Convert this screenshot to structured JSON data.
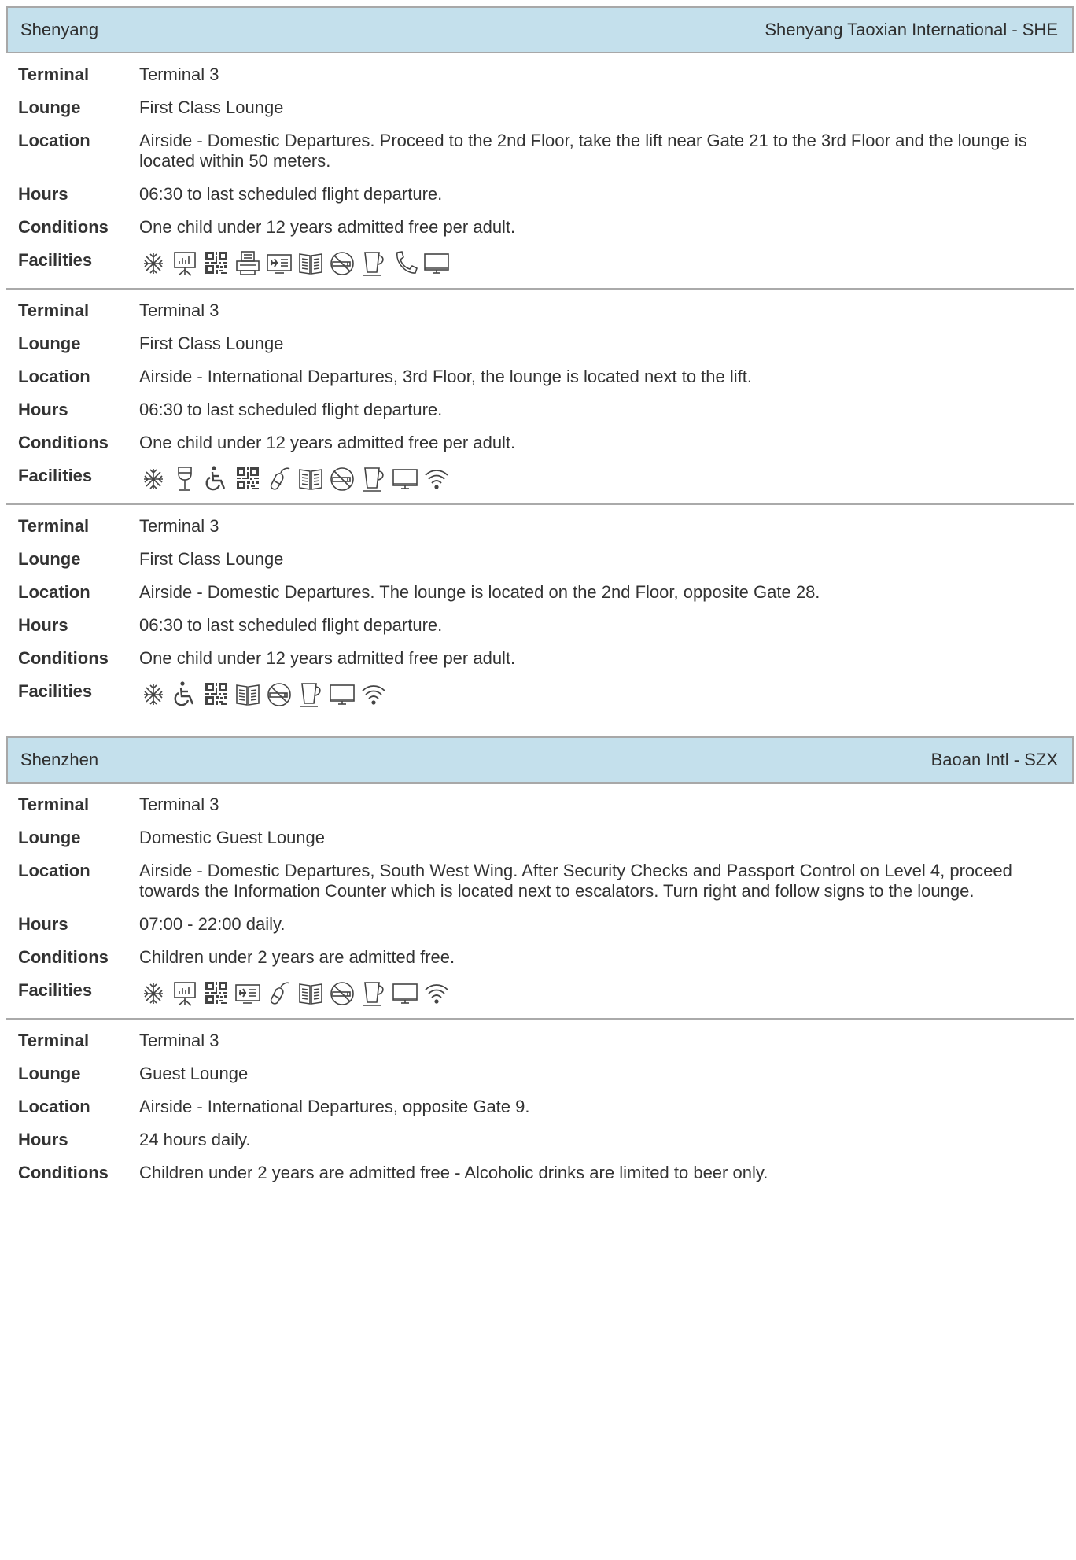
{
  "labels": {
    "terminal": "Terminal",
    "lounge": "Lounge",
    "location": "Location",
    "hours": "Hours",
    "conditions": "Conditions",
    "facilities": "Facilities"
  },
  "cities": [
    {
      "city": "Shenyang",
      "airport": "Shenyang Taoxian International - SHE",
      "lounges": [
        {
          "terminal": "Terminal 3",
          "lounge": "First Class Lounge",
          "location": "Airside - Domestic Departures. Proceed to the 2nd Floor, take the lift near Gate 21 to the 3rd Floor and the lounge is located within 50 meters.",
          "hours": "06:30 to last scheduled flight departure.",
          "conditions": "One child under 12 years admitted free per adult.",
          "facilities": [
            "air-conditioning-icon",
            "conference-icon",
            "flight-info-qr-icon",
            "fax-icon",
            "flight-monitor-icon",
            "newspapers-icon",
            "no-smoking-icon",
            "refreshments-icon",
            "telephone-icon",
            "tv-icon"
          ]
        },
        {
          "terminal": "Terminal 3",
          "lounge": "First Class Lounge",
          "location": "Airside - International Departures, 3rd Floor, the lounge is located next to the lift.",
          "hours": "06:30 to last scheduled flight departure.",
          "conditions": "One child under 12 years admitted free per adult.",
          "facilities": [
            "air-conditioning-icon",
            "alcohol-icon",
            "wheelchair-icon",
            "flight-info-qr-icon",
            "internet-mouse-icon",
            "newspapers-icon",
            "no-smoking-icon",
            "refreshments-icon",
            "tv-icon",
            "wifi-icon"
          ]
        },
        {
          "terminal": "Terminal 3",
          "lounge": "First Class Lounge",
          "location": "Airside - Domestic Departures. The lounge is located on the 2nd Floor, opposite Gate 28.",
          "hours": "06:30 to last scheduled flight departure.",
          "conditions": "One child under 12 years admitted free per adult.",
          "facilities": [
            "air-conditioning-icon",
            "wheelchair-icon",
            "flight-info-qr-icon",
            "newspapers-icon",
            "no-smoking-icon",
            "refreshments-icon",
            "tv-icon",
            "wifi-icon"
          ]
        }
      ]
    },
    {
      "city": "Shenzhen",
      "airport": "Baoan Intl - SZX",
      "lounges": [
        {
          "terminal": "Terminal 3",
          "lounge": "Domestic Guest Lounge",
          "location": "Airside - Domestic Departures, South West Wing. After Security Checks and Passport Control on Level 4, proceed towards the Information Counter which is located next to escalators. Turn right and follow signs to the lounge.",
          "hours": "07:00 - 22:00 daily.",
          "conditions": "Children under 2 years are admitted free.",
          "facilities": [
            "air-conditioning-icon",
            "conference-icon",
            "flight-info-qr-icon",
            "flight-monitor-icon",
            "internet-mouse-icon",
            "newspapers-icon",
            "no-smoking-icon",
            "refreshments-icon",
            "tv-icon",
            "wifi-icon"
          ]
        },
        {
          "terminal": "Terminal 3",
          "lounge": "Guest Lounge",
          "location": "Airside - International Departures, opposite Gate 9.",
          "hours": "24 hours daily.",
          "conditions": "Children under 2 years are admitted free - Alcoholic drinks are limited to beer only.",
          "facilities": []
        }
      ]
    }
  ]
}
